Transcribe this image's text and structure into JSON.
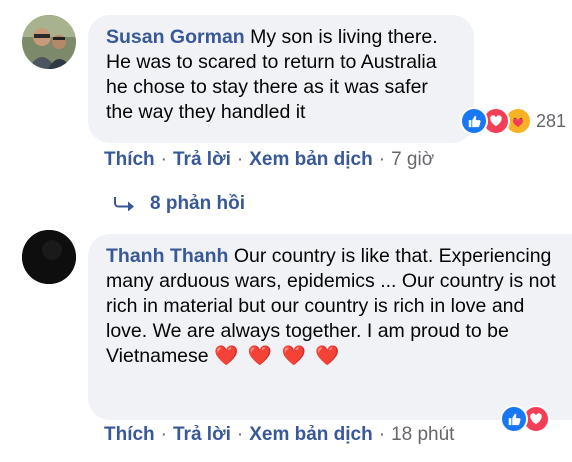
{
  "comments": [
    {
      "author": "Susan Gorman",
      "text": "My son is living there. He was to scared to return to Australia he chose to stay there as it was safer the way they handled it",
      "reactions": {
        "icons": [
          "like-icon",
          "love-icon",
          "care-icon"
        ],
        "count": "281"
      },
      "actions": {
        "like": "Thích",
        "reply": "Trả lời",
        "translate": "Xem bản dịch",
        "time": "7 giờ"
      },
      "replies_label": "8 phản hồi"
    },
    {
      "author": "Thanh Thanh",
      "text": "Our country is like that. Experiencing many arduous wars, epidemics ... Our country is not rich in material but our country is rich in love and love. We are always together. I am proud to be Vietnamese",
      "text_emoji": "❤️ ❤️ ❤️ ❤️",
      "reactions": {
        "icons": [
          "like-icon",
          "love-icon"
        ]
      },
      "actions": {
        "like": "Thích",
        "reply": "Trả lời",
        "translate": "Xem bản dịch",
        "time": "18 phút"
      }
    }
  ],
  "colors": {
    "link": "#385898",
    "muted": "#65676b",
    "bubble": "#f0f2f5",
    "like": "#1877f2",
    "love": "#f33e58",
    "heart": "#e8112d"
  }
}
